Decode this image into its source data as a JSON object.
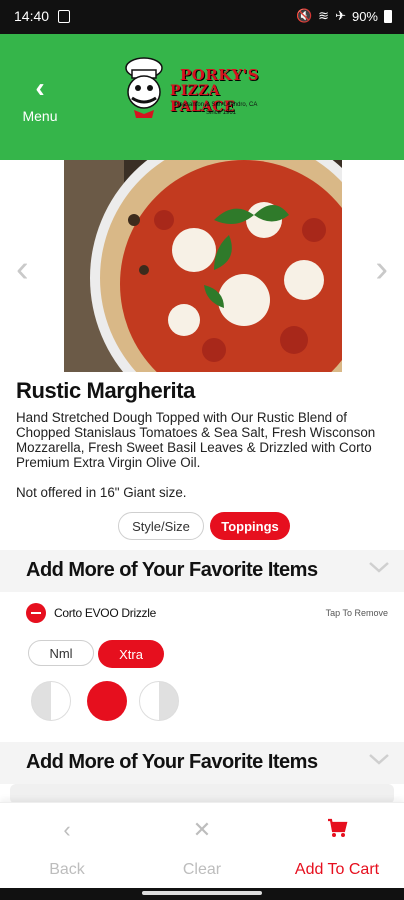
{
  "status_bar": {
    "time": "14:40",
    "battery": "90%"
  },
  "header": {
    "back_label": "Menu",
    "logo": {
      "line1": "PORKY'S",
      "line2": "PIZZA PALACE",
      "tagline1": "Pleasanton & San Leandro, CA",
      "tagline2": "Since 1961"
    },
    "bg_color": "#35b54a"
  },
  "product": {
    "name": "Rustic Margherita",
    "description": "Hand Stretched Dough Topped with Our Rustic Blend of Chopped Stanislaus Tomatoes & Sea Salt, Fresh Wisconson Mozzarella, Fresh Sweet Basil Leaves & Drizzled with Corto Premium Extra Virgin Olive Oil.",
    "note": "Not offered in 16\" Giant size."
  },
  "tabs": {
    "style_size": "Style/Size",
    "toppings": "Toppings",
    "active": "Toppings"
  },
  "sections": [
    {
      "title": "Add More of Your Favorite Items"
    },
    {
      "title": "Add More of Your Favorite Items"
    }
  ],
  "topping": {
    "name": "Corto EVOO Drizzle",
    "hint": "Tap To Remove",
    "amount_options": [
      "Nml",
      "Xtra"
    ],
    "amount_selected": "Xtra",
    "portion_selected": "whole"
  },
  "bottom_bar": {
    "back": "Back",
    "clear": "Clear",
    "add_to_cart": "Add To Cart"
  },
  "colors": {
    "accent": "#e60f1e",
    "header_green": "#35b54a",
    "disabled": "#bdbdbd"
  }
}
